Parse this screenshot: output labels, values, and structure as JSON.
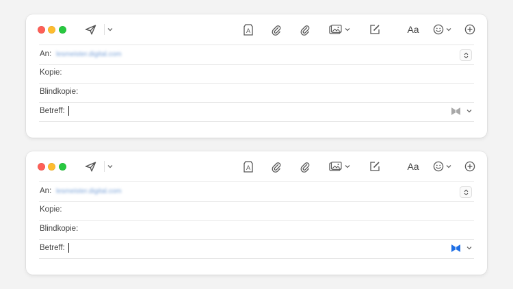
{
  "windows": [
    {
      "id": "compose-1",
      "toolbar": {
        "font_label": "Aa"
      },
      "fields": {
        "to_label": "An:",
        "to_value": "lesmeister.digital.com",
        "cc_label": "Kopie:",
        "bcc_label": "Blindkopie:",
        "subject_label": "Betreff:",
        "subject_value": ""
      },
      "stationery_icon_color": "#a8a8a8"
    },
    {
      "id": "compose-2",
      "toolbar": {
        "font_label": "Aa"
      },
      "fields": {
        "to_label": "An:",
        "to_value": "lesmeister.digital.com",
        "cc_label": "Kopie:",
        "bcc_label": "Blindkopie:",
        "subject_label": "Betreff:",
        "subject_value": ""
      },
      "stationery_icon_color": "#1f6fe5"
    }
  ],
  "icons": [
    "close-icon",
    "minimize-icon",
    "zoom-icon",
    "send-icon",
    "chevron-down-icon",
    "format-icon",
    "attachment-icon",
    "attachment-alt-icon",
    "photo-icon",
    "markup-icon",
    "emoji-icon",
    "add-icon",
    "stepper-icon",
    "stationery-icon"
  ]
}
